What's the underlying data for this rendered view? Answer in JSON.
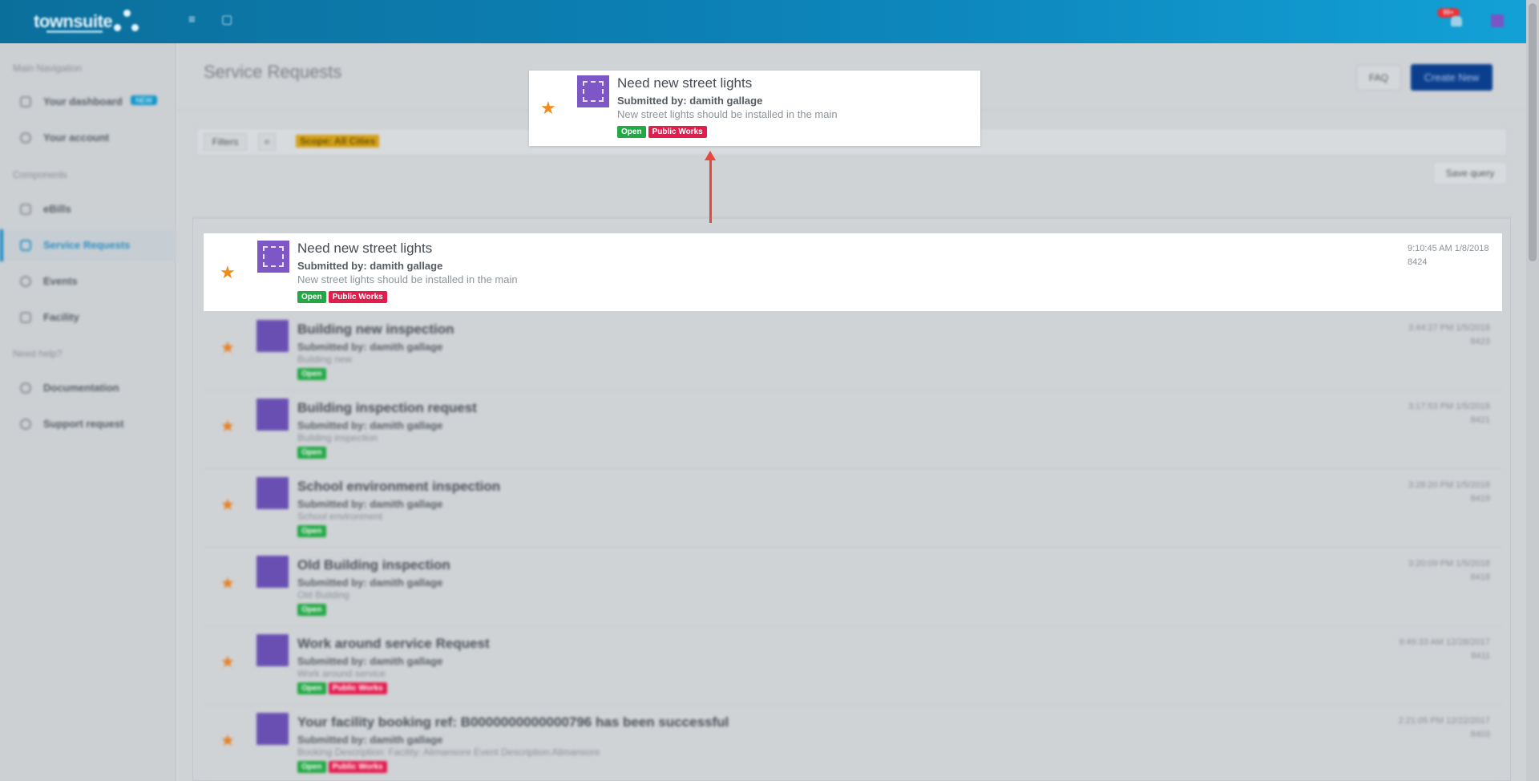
{
  "topbar": {
    "brand": "townsuite",
    "notification_count": "99+",
    "colors": {
      "bar": "#0d86bc",
      "badge": "#e6343a"
    }
  },
  "sidebar": {
    "sections": [
      {
        "heading": "Main Navigation",
        "items": [
          {
            "label": "Your dashboard",
            "icon": "dashboard-icon",
            "badge": "NEW"
          },
          {
            "label": "Your account",
            "icon": "account-icon"
          }
        ]
      },
      {
        "heading": "Components",
        "items": [
          {
            "label": "eBills",
            "icon": "bill-icon"
          },
          {
            "label": "Service Requests",
            "icon": "request-icon",
            "active": true
          },
          {
            "label": "Events",
            "icon": "event-icon"
          },
          {
            "label": "Facility",
            "icon": "facility-icon"
          }
        ]
      },
      {
        "heading": "Need help?",
        "items": [
          {
            "label": "Documentation",
            "icon": "documentation-icon"
          },
          {
            "label": "Support request",
            "icon": "support-icon"
          }
        ]
      }
    ]
  },
  "header": {
    "title": "Service Requests",
    "faq_label": "FAQ",
    "create_label": "Create New"
  },
  "filters": {
    "filters_label": "Filters",
    "operator": "=",
    "chip": "Scope: All Cities",
    "save_query_label": "Save query"
  },
  "callout": {
    "title": "Need new street lights",
    "submitted": "Submitted by: damith gallage",
    "description": "New street lights should be installed in the main",
    "tags": [
      "Open",
      "Public Works"
    ]
  },
  "highlighted": {
    "title": "Need new street lights",
    "submitted": "Submitted by: damith gallage",
    "description": "New street lights should be installed in the main",
    "tags": [
      "Open",
      "Public Works"
    ],
    "time": "9:10:45 AM 1/8/2018",
    "id": "8424"
  },
  "rows": [
    {
      "title": "Building new inspection",
      "submitted": "Submitted by: damith gallage",
      "description": "Building new",
      "tags": [
        "Open"
      ],
      "time": "3:44:27 PM 1/5/2018",
      "id": "8423"
    },
    {
      "title": "Building inspection request",
      "submitted": "Submitted by: damith gallage",
      "description": "Building inspection",
      "tags": [
        "Open"
      ],
      "time": "3:17:53 PM 1/5/2018",
      "id": "8421"
    },
    {
      "title": "School environment inspection",
      "submitted": "Submitted by: damith gallage",
      "description": "School environment",
      "tags": [
        "Open"
      ],
      "time": "3:28:20 PM 1/5/2018",
      "id": "8419"
    },
    {
      "title": "Old Building inspection",
      "submitted": "Submitted by: damith gallage",
      "description": "Old Building",
      "tags": [
        "Open"
      ],
      "time": "3:20:09 PM 1/5/2018",
      "id": "8418"
    },
    {
      "title": "Work around service Request",
      "submitted": "Submitted by: damith gallage",
      "description": "Work around service",
      "tags": [
        "Open",
        "Public Works"
      ],
      "time": "9:49:33 AM 12/28/2017",
      "id": "8411"
    },
    {
      "title": "Your facility booking ref: B0000000000000796 has been successful",
      "submitted": "Submitted by: damith gallage",
      "description": "Booking Description: Facility: Alimansore Event Description:Alimansore",
      "tags": [
        "Open",
        "Public Works"
      ],
      "time": "2:21:05 PM 12/22/2017",
      "id": "8403"
    }
  ]
}
